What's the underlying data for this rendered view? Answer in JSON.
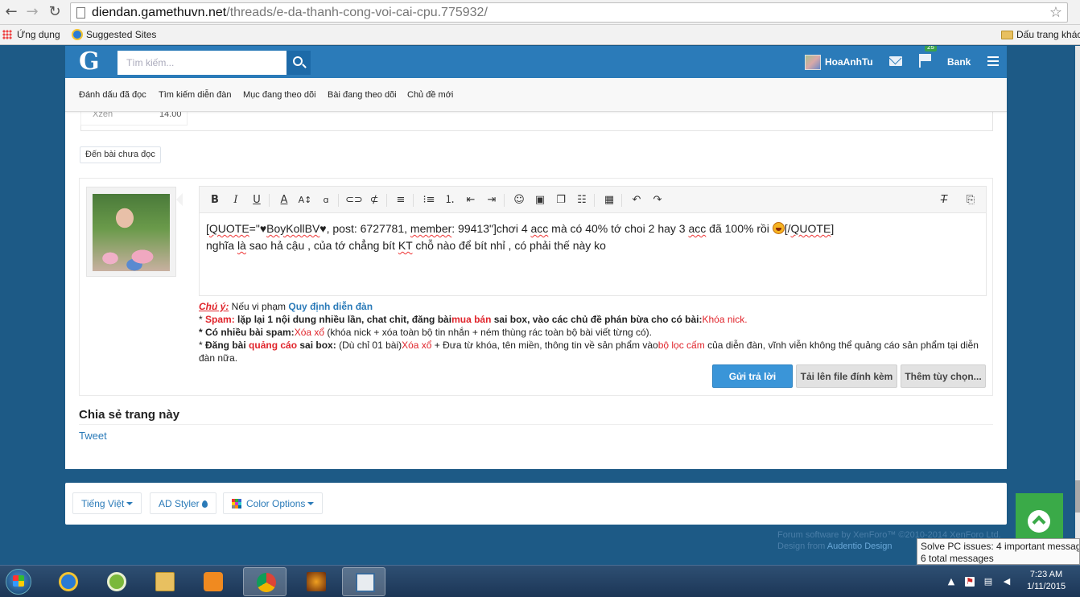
{
  "browser": {
    "url_host": "diendan.gamethuvn.net",
    "url_path": "/threads/e-da-thanh-cong-voi-cai-cpu.775932/",
    "bookmarks": {
      "apps": "Ứng dụng",
      "suggested": "Suggested Sites",
      "other": "Dấu trang khác"
    }
  },
  "header": {
    "logo": "G",
    "search_placeholder": "Tìm kiếm...",
    "username": "HoaAnhTu",
    "notification_count": "25",
    "bank": "Bank"
  },
  "subnav": {
    "links": [
      "Đánh dấu đã đọc",
      "Tìm kiếm diễn đàn",
      "Mục đang theo dõi",
      "Bài đang theo dõi",
      "Chủ đề mới"
    ]
  },
  "previous_post": {
    "stat_label": "Xzen",
    "stat_value": "14.00"
  },
  "unread_button": "Đến bài chưa đọc",
  "editor": {
    "line1_prefix": "[",
    "line1_quote": "QUOTE",
    "line1_eq": "=\"♥",
    "line1_name": "BoyKollBV",
    "line1_mid": "♥, post: 6727781, ",
    "line1_member": "member",
    "line1_after_member": ": 99413\"]chơi 4 ",
    "line1_acc1": "acc",
    "line1_mid2": " mà có 40% tớ choi 2 hay 3 ",
    "line1_acc2": "acc",
    "line1_end": " đã 100% rồi ",
    "line1_close_open": "[/",
    "line1_close_tag": "QUOTE",
    "line1_close": "]",
    "line2_a": "nghĩa ",
    "line2_la": "là",
    "line2_b": " sao hả cậu , của tớ chẳng bít ",
    "line2_kt": "KT",
    "line2_c": " chỗ nào để bít nhỉ , có phải thế này ko"
  },
  "rules": {
    "note_label": "Chú ý:",
    "note_text": " Nếu vi phạm ",
    "rules_link": "Quy định diễn đàn",
    "l1_star": "* ",
    "l1_spam": "Spam:",
    "l1_text": " lặp lại 1 nội dung nhiều lần, chat chit, đăng bài",
    "l1_buy": "mua bán",
    "l1_text2": " sai box, vào các chủ đề phán bừa cho có bài:",
    "l1_penalty": "Khóa nick.",
    "l2_text": "* Có nhiều bài spam:",
    "l2_penalty": "Xóa xổ",
    "l2_rest": " (khóa nick + xóa toàn bộ tin nhắn + ném thùng rác toàn bộ bài viết từng có).",
    "l3_star": "* ",
    "l3_post": "Đăng bài ",
    "l3_ad": "quảng cáo",
    "l3_box": " sai box:",
    "l3_text": " (Dù chỉ 01 bài)",
    "l3_penalty": "Xóa xổ",
    "l3_text2": " + Đưa từ khóa, tên miền, thông tin về sản phẩm vào",
    "l3_filter": "bộ lọc cấm",
    "l3_text3": " của diễn đàn, vĩnh viễn không thể quảng cáo sản phẩm tại diễn đàn nữa."
  },
  "actions": {
    "submit": "Gửi trả lời",
    "upload": "Tải lên file đính kèm",
    "options": "Thêm tùy chọn..."
  },
  "share": {
    "title": "Chia sẻ trang này",
    "tweet": "Tweet"
  },
  "footer": {
    "language": "Tiếng Việt",
    "styler": "AD Styler",
    "color_options": "Color Options",
    "credit_line1": "Forum software by XenForo™ ©2010-2014 XenForo Ltd.",
    "credit_line2_prefix": "Design from ",
    "credit_line2_link": "Audentio Design"
  },
  "tooltip": {
    "line1": "Solve PC issues: 4 important messages",
    "line2": "6 total messages"
  },
  "taskbar": {
    "time": "7:23 AM",
    "date": "1/11/2015"
  },
  "colors": {
    "header_blue": "#2b7bb9",
    "page_bg": "#1d5a86",
    "submit_blue": "#3a95d8",
    "warning_red": "#e0242b",
    "back_to_top_green": "#3aaa48"
  }
}
